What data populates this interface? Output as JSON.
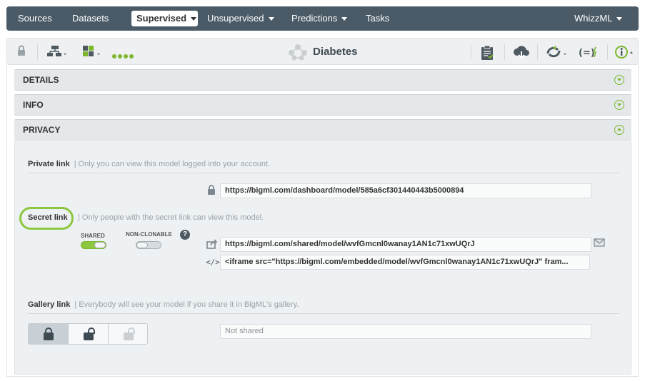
{
  "nav": {
    "items": [
      "Sources",
      "Datasets"
    ],
    "active": "Supervised",
    "unsupervised": "Unsupervised",
    "predictions": "Predictions",
    "tasks": "Tasks",
    "user": "WhizzML"
  },
  "toolbar": {
    "title": "Diabetes"
  },
  "sections": {
    "details": "DETAILS",
    "info": "INFO",
    "privacy": "PRIVACY"
  },
  "privacy": {
    "private_link": {
      "title": "Private link",
      "desc": "| Only you can view this model logged into your account.",
      "url": "https://bigml.com/dashboard/model/585a6cf301440443b5000894"
    },
    "secret_link": {
      "title": "Secret link",
      "desc": "| Only people with the secret link can view this model.",
      "shared_label": "SHARED",
      "nonclonable_label": "NON-CLONABLE",
      "url": "https://bigml.com/shared/model/wvfGmcnl0wanay1AN1c71xwUQrJ",
      "embed": "<iframe src=\"https://bigml.com/embedded/model/wvfGmcnl0wanay1AN1c71xwUQrJ\" fram...",
      "shared_on": true,
      "nonclonable_on": false
    },
    "gallery_link": {
      "title": "Gallery link",
      "desc": "| Everybody will see your model if you share it in BigML's gallery.",
      "status": "Not shared"
    }
  },
  "colors": {
    "accent": "#7cb82f",
    "nav_bg": "#4a5b67"
  }
}
